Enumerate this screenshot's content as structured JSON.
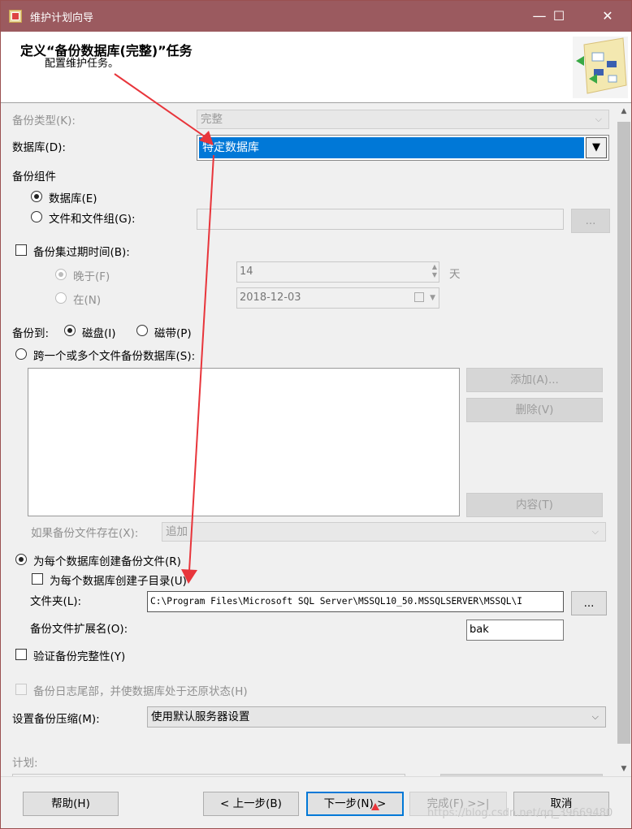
{
  "window": {
    "title": "维护计划向导",
    "minimize_glyph": "—",
    "maximize_glyph": "☐",
    "close_glyph": "✕"
  },
  "header": {
    "title": "定义“备份数据库(完整)”任务",
    "subtitle": "配置维护任务。"
  },
  "backup_type": {
    "label": "备份类型(K):",
    "value": "完整"
  },
  "database": {
    "label": "数据库(D):",
    "value": "特定数据库"
  },
  "backup_component": {
    "label": "备份组件",
    "database_option": "数据库(E)",
    "files_option": "文件和文件组(G):",
    "browse_label": "..."
  },
  "expiry": {
    "checkbox_label": "备份集过期时间(B):",
    "after_label": "晚于(F)",
    "after_value": "14",
    "after_unit": "天",
    "on_label": "在(N)",
    "on_value": "2018-12-03"
  },
  "backup_to": {
    "label": "备份到:",
    "disk_label": "磁盘(I)",
    "tape_label": "磁带(P)"
  },
  "span_files": {
    "label": "跨一个或多个文件备份数据库(S):",
    "add_label": "添加(A)...",
    "delete_label": "删除(V)",
    "contents_label": "内容(T)",
    "exists_label": "如果备份文件存在(X):",
    "exists_value": "追加"
  },
  "per_database": {
    "label": "为每个数据库创建备份文件(R)",
    "subdir_label": "为每个数据库创建子目录(U)",
    "folder_label": "文件夹(L):",
    "folder_value": "C:\\Program Files\\Microsoft SQL Server\\MSSQL10_50.MSSQLSERVER\\MSSQL\\I",
    "folder_browse": "...",
    "ext_label": "备份文件扩展名(O):",
    "ext_value": "bak"
  },
  "verify": {
    "label": "验证备份完整性(Y)"
  },
  "tail_log": {
    "label": "备份日志尾部，并使数据库处于还原状态(H)"
  },
  "compression": {
    "label": "设置备份压缩(M):",
    "value": "使用默认服务器设置"
  },
  "schedule": {
    "label": "计划:"
  },
  "footer": {
    "help": "帮助(H)",
    "back": "< 上一步(B)",
    "next": "下一步(N) >",
    "finish": "完成(F) >>|",
    "cancel": "取消"
  },
  "watermark": "https://blog.csdn.net/qq_39669480",
  "colors": {
    "titlebar": "#9b5a5f",
    "selection": "#0078d7",
    "annotation_arrow": "#e8353b"
  }
}
